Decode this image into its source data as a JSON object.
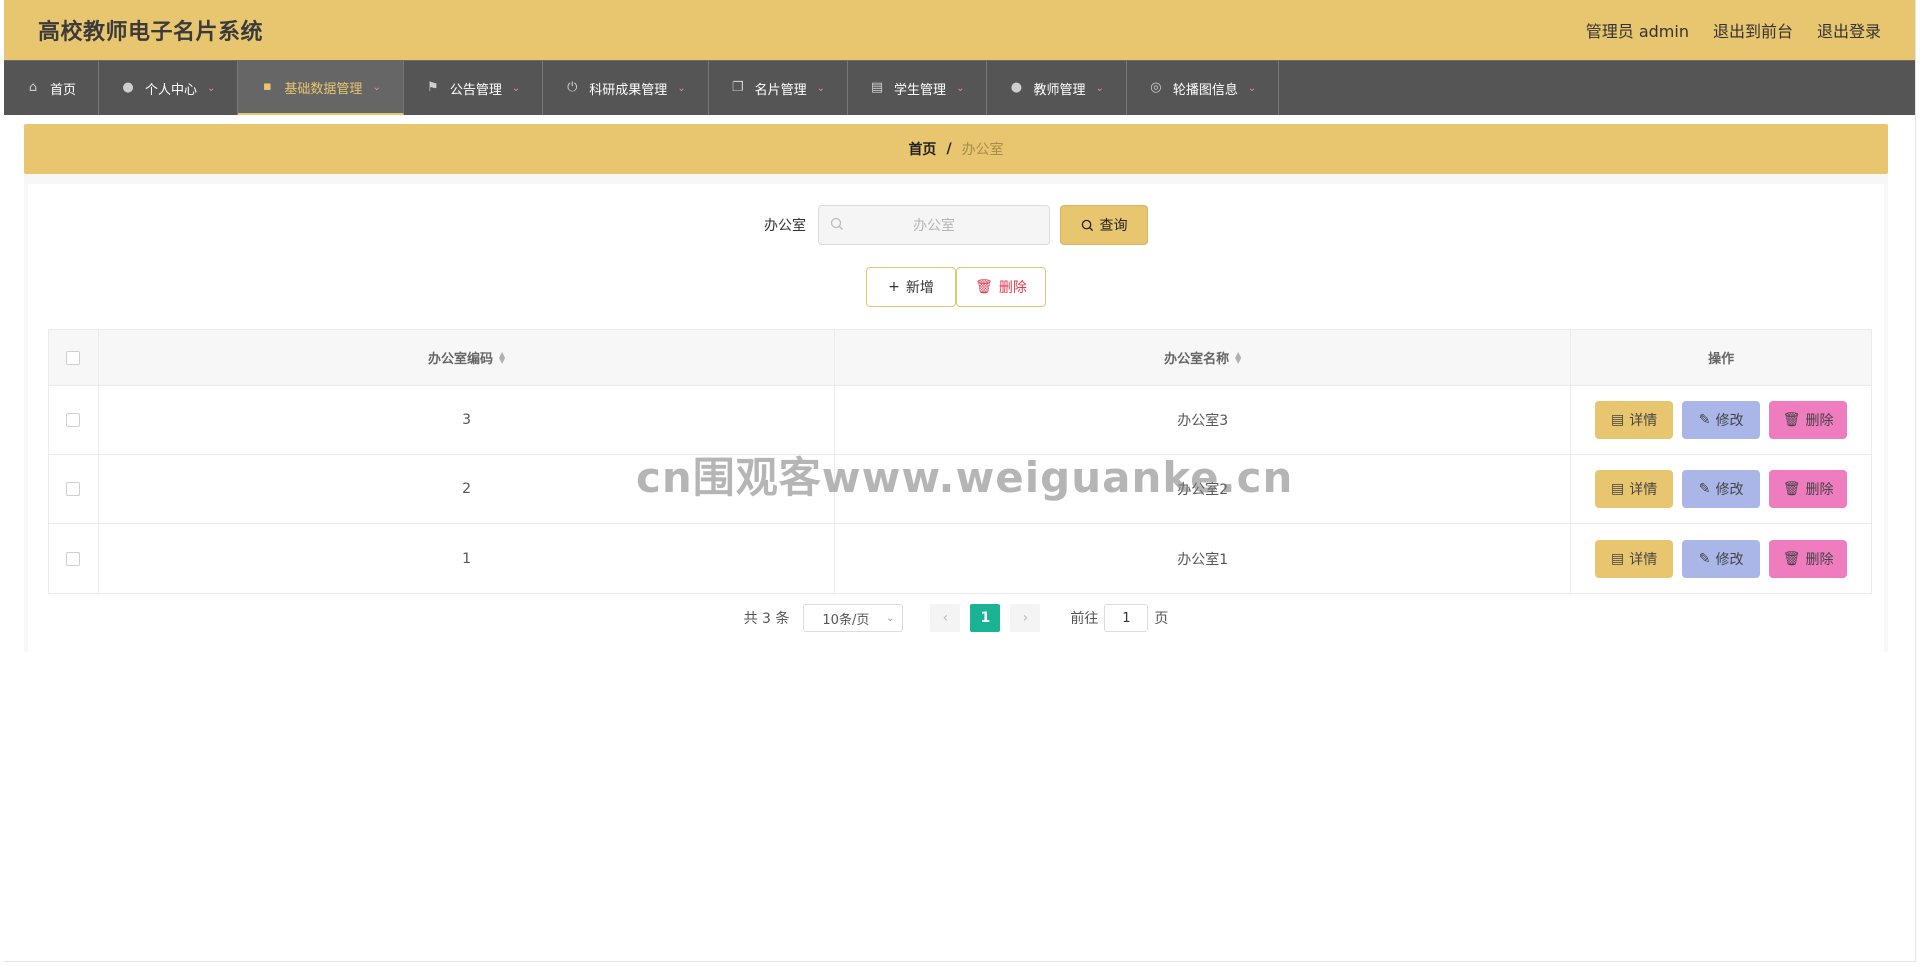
{
  "app": {
    "title": "高校教师电子名片系统",
    "admin_label": "管理员 admin",
    "back_front": "退出到前台",
    "logout": "退出登录"
  },
  "nav": [
    {
      "label": "首页",
      "icon": "home-icon",
      "has_dropdown": false,
      "active": false
    },
    {
      "label": "个人中心",
      "icon": "user-icon",
      "has_dropdown": true,
      "active": false
    },
    {
      "label": "基础数据管理",
      "icon": "chat-icon",
      "has_dropdown": true,
      "active": true
    },
    {
      "label": "公告管理",
      "icon": "flag-icon",
      "has_dropdown": true,
      "active": false
    },
    {
      "label": "科研成果管理",
      "icon": "power-icon",
      "has_dropdown": true,
      "active": false
    },
    {
      "label": "名片管理",
      "icon": "copy-icon",
      "has_dropdown": true,
      "active": false
    },
    {
      "label": "学生管理",
      "icon": "clipboard-icon",
      "has_dropdown": true,
      "active": false
    },
    {
      "label": "教师管理",
      "icon": "user-icon",
      "has_dropdown": true,
      "active": false
    },
    {
      "label": "轮播图信息",
      "icon": "target-icon",
      "has_dropdown": true,
      "active": false
    }
  ],
  "breadcrumb": {
    "home": "首页",
    "separator": "/",
    "current": "办公室"
  },
  "search": {
    "label": "办公室",
    "placeholder": "办公室",
    "button": "查询"
  },
  "actions": {
    "add": "新增",
    "delete": "删除"
  },
  "table": {
    "headers": {
      "code": "办公室编码",
      "name": "办公室名称",
      "ops": "操作"
    },
    "rows": [
      {
        "code": "3",
        "name": "办公室3"
      },
      {
        "code": "2",
        "name": "办公室2"
      },
      {
        "code": "1",
        "name": "办公室1"
      }
    ],
    "op_labels": {
      "detail": "详情",
      "edit": "修改",
      "delete": "删除"
    }
  },
  "pagination": {
    "total": "共 3 条",
    "page_size": "10条/页",
    "current_page": "1",
    "goto_prefix": "前往",
    "goto_value": "1",
    "goto_suffix": "页"
  },
  "watermark": "cn围观客www.weiguanke.cn",
  "colors": {
    "header": "#e8c66f",
    "nav": "#555555",
    "active_page": "#1ab394",
    "edit": "#aab6e8",
    "delete": "#f07cc0"
  }
}
